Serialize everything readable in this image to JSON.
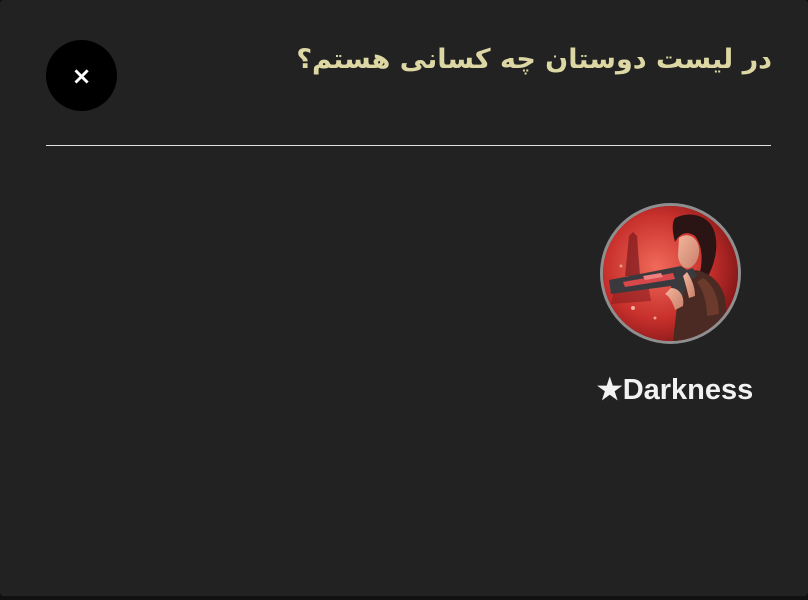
{
  "dialog": {
    "title": "در لیست دوستان چه کسانی هستم؟",
    "close_icon": "close-icon",
    "close_glyph": "×"
  },
  "friends": [
    {
      "name": "★Darkness",
      "avatar": "game-character-avatar"
    }
  ],
  "colors": {
    "background": "#222223",
    "title": "#ddd7a4",
    "close_button_bg": "#000000",
    "divider": "#e0e0e0",
    "name": "#f2f2f2"
  }
}
